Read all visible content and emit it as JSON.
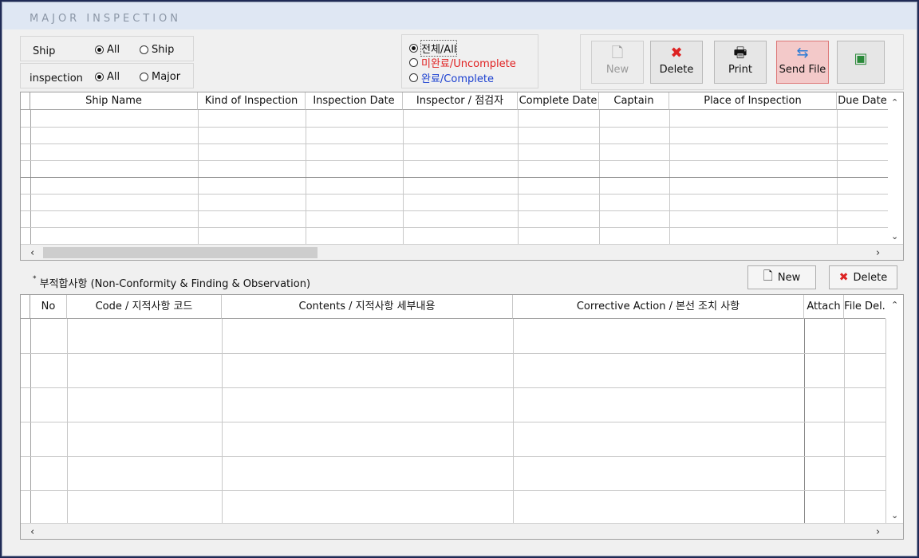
{
  "window": {
    "title": "MAJOR INSPECTION"
  },
  "filters": {
    "ship_label": "Ship",
    "ship_all": "All",
    "ship_ship": "Ship",
    "inspection_label": "inspection",
    "insp_all": "All",
    "insp_major": "Major"
  },
  "status": {
    "all": "전체/All",
    "uncomplete": "미완료/Uncomplete",
    "complete": "완료/Complete",
    "colors": {
      "uncomplete": "#e02020",
      "complete": "#1a3fd0"
    }
  },
  "toolbar": {
    "new": "New",
    "delete": "Delete",
    "print": "Print",
    "send_file": "Send File"
  },
  "inspection_table": {
    "columns": [
      "Ship Name",
      "Kind of Inspection",
      "Inspection Date",
      "Inspector / 점검자",
      "Complete Date",
      "Captain",
      "Place of Inspection",
      "Due Date"
    ]
  },
  "findings": {
    "title": "부적합사항 (Non-Conformity & Finding & Observation)",
    "new": "New",
    "delete": "Delete",
    "columns": [
      "No",
      "Code / 지적사항 코드",
      "Contents / 지적사항 세부내용",
      "Corrective Action / 본선 조치 사항",
      "Attach",
      "File Del."
    ]
  }
}
